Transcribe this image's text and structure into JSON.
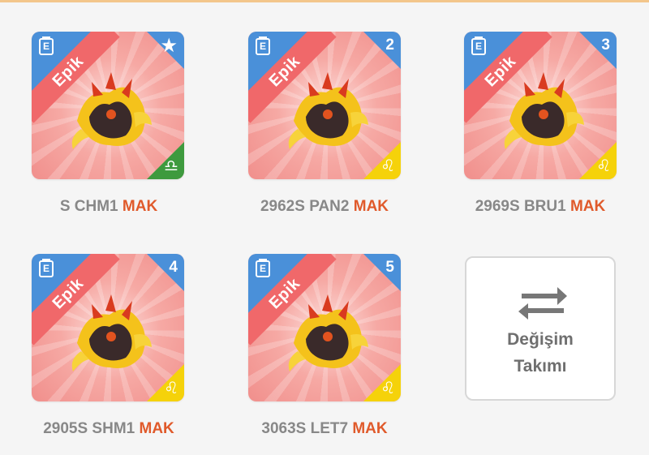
{
  "cards": [
    {
      "rarity": "Epik",
      "badge_type": "star",
      "badge": "★",
      "sign_icon": "libra-icon",
      "sign": "♎",
      "sign_color": "#3e9a3e",
      "name": "S CHM1",
      "level": "MAK"
    },
    {
      "rarity": "Epik",
      "badge_type": "number",
      "badge": "2",
      "sign_icon": "leo-icon",
      "sign": "♌",
      "sign_color": "#f5d20a",
      "name": "2962S PAN2",
      "level": "MAK"
    },
    {
      "rarity": "Epik",
      "badge_type": "number",
      "badge": "3",
      "sign_icon": "leo-icon",
      "sign": "♌",
      "sign_color": "#f5d20a",
      "name": "2969S BRU1",
      "level": "MAK"
    },
    {
      "rarity": "Epik",
      "badge_type": "number",
      "badge": "4",
      "sign_icon": "leo-icon",
      "sign": "♌",
      "sign_color": "#f5d20a",
      "name": "2905S SHM1",
      "level": "MAK"
    },
    {
      "rarity": "Epik",
      "badge_type": "number",
      "badge": "5",
      "sign_icon": "leo-icon",
      "sign": "♌",
      "sign_color": "#f5d20a",
      "name": "3063S LET7",
      "level": "MAK"
    }
  ],
  "doc_icon_letter": "E",
  "swap": {
    "line1": "Değişim",
    "line2": "Takımı",
    "icon": "swap-arrows-icon"
  },
  "colors": {
    "accent": "#e05a2b",
    "blue": "#4a90d9",
    "card_pink": "#f08d8a",
    "ribbon": "#f0686a"
  }
}
